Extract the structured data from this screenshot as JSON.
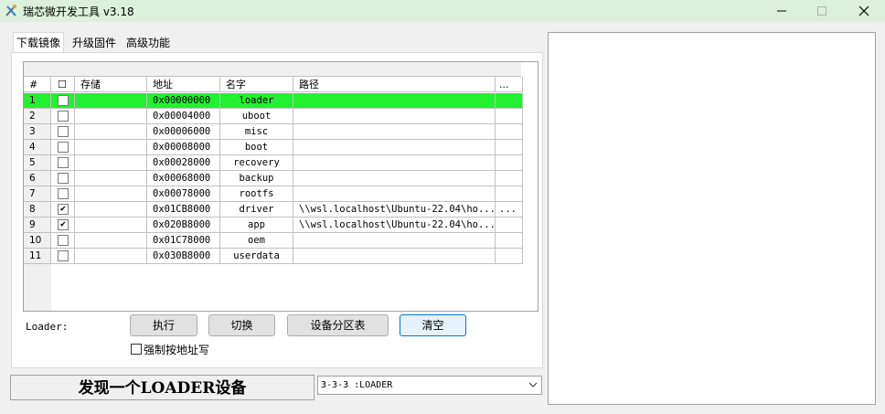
{
  "window": {
    "title": "瑞芯微开发工具 v3.18"
  },
  "tabs": [
    {
      "label": "下载镜像",
      "active": true
    },
    {
      "label": "升级固件",
      "active": false
    },
    {
      "label": "高级功能",
      "active": false
    }
  ],
  "grid": {
    "headers": {
      "num": "#",
      "check": "☐",
      "storage": "存储",
      "address": "地址",
      "name": "名字",
      "path": "路径",
      "more": "..."
    },
    "rows": [
      {
        "num": "1",
        "checked": false,
        "storage": "",
        "address": "0x00000000",
        "name": "loader",
        "path": "",
        "more": "",
        "selected": true
      },
      {
        "num": "2",
        "checked": false,
        "storage": "",
        "address": "0x00004000",
        "name": "uboot",
        "path": "",
        "more": "",
        "selected": false
      },
      {
        "num": "3",
        "checked": false,
        "storage": "",
        "address": "0x00006000",
        "name": "misc",
        "path": "",
        "more": "",
        "selected": false
      },
      {
        "num": "4",
        "checked": false,
        "storage": "",
        "address": "0x00008000",
        "name": "boot",
        "path": "",
        "more": "",
        "selected": false
      },
      {
        "num": "5",
        "checked": false,
        "storage": "",
        "address": "0x00028000",
        "name": "recovery",
        "path": "",
        "more": "",
        "selected": false
      },
      {
        "num": "6",
        "checked": false,
        "storage": "",
        "address": "0x00068000",
        "name": "backup",
        "path": "",
        "more": "",
        "selected": false
      },
      {
        "num": "7",
        "checked": false,
        "storage": "",
        "address": "0x00078000",
        "name": "rootfs",
        "path": "",
        "more": "",
        "selected": false
      },
      {
        "num": "8",
        "checked": true,
        "storage": "",
        "address": "0x01CB8000",
        "name": "driver",
        "path": "\\\\wsl.localhost\\Ubuntu-22.04\\ho...",
        "more": "...",
        "selected": false
      },
      {
        "num": "9",
        "checked": true,
        "storage": "",
        "address": "0x020B8000",
        "name": "app",
        "path": "\\\\wsl.localhost\\Ubuntu-22.04\\ho...",
        "more": "",
        "selected": false
      },
      {
        "num": "10",
        "checked": false,
        "storage": "",
        "address": "0x01C78000",
        "name": "oem",
        "path": "",
        "more": "",
        "selected": false
      },
      {
        "num": "11",
        "checked": false,
        "storage": "",
        "address": "0x030B8000",
        "name": "userdata",
        "path": "",
        "more": "",
        "selected": false
      }
    ]
  },
  "controls": {
    "loader_label": "Loader:",
    "execute": "执行",
    "switch": "切换",
    "partition_table": "设备分区表",
    "clear": "清空",
    "force_address_label": "强制按地址写",
    "force_address_checked": false
  },
  "status": {
    "message": "发现一个LOADER设备",
    "device_select": "3-3-3 :LOADER"
  },
  "colors": {
    "selected_row": "#22f030",
    "titlebar": "#dcf0dc",
    "focus_border": "#0078d7"
  }
}
